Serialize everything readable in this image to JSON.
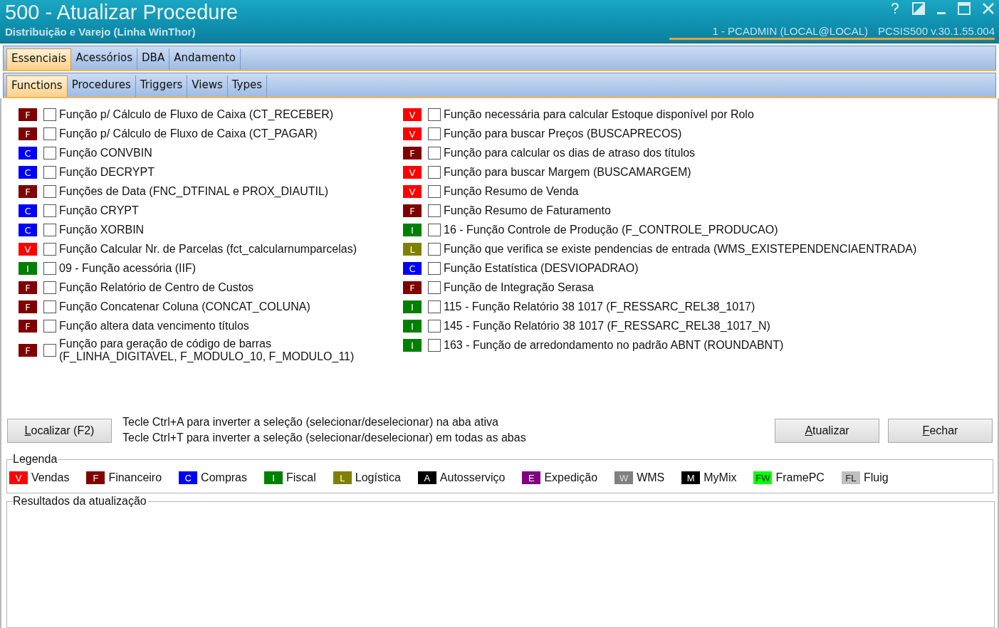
{
  "window": {
    "title": "500 - Atualizar Procedure",
    "subtitle": "Distribuição e Varejo (Linha WinThor)",
    "user": "1 - PCADMIN (LOCAL@LOCAL)",
    "version": "PCSIS500  v.30.1.55.004"
  },
  "tabs": [
    {
      "label": "Essenciais",
      "selected": true
    },
    {
      "label": "Acessórios",
      "selected": false
    },
    {
      "label": "DBA",
      "selected": false
    },
    {
      "label": "Andamento",
      "selected": false
    }
  ],
  "subtabs": [
    {
      "label": "Functions",
      "selected": true
    },
    {
      "label": "Procedures",
      "selected": false
    },
    {
      "label": "Triggers",
      "selected": false
    },
    {
      "label": "Views",
      "selected": false
    },
    {
      "label": "Types",
      "selected": false
    }
  ],
  "columns": [
    [
      {
        "badge": "F",
        "color": "#800000",
        "label": "Função p/ Cálculo de Fluxo de Caixa (CT_RECEBER)",
        "checked": false
      },
      {
        "badge": "F",
        "color": "#800000",
        "label": "Função p/ Cálculo de Fluxo de Caixa (CT_PAGAR)",
        "checked": false
      },
      {
        "badge": "C",
        "color": "#0000ff",
        "label": "Função CONVBIN",
        "checked": false
      },
      {
        "badge": "C",
        "color": "#0000ff",
        "label": "Função DECRYPT",
        "checked": false
      },
      {
        "badge": "F",
        "color": "#800000",
        "label": "Funções de Data (FNC_DTFINAL e PROX_DIAUTIL)",
        "checked": false
      },
      {
        "badge": "C",
        "color": "#0000ff",
        "label": "Função CRYPT",
        "checked": false
      },
      {
        "badge": "C",
        "color": "#0000ff",
        "label": "Função XORBIN",
        "checked": false
      },
      {
        "badge": "V",
        "color": "#ff0000",
        "label": "Função Calcular Nr. de Parcelas (fct_calcularnumparcelas)",
        "checked": false
      },
      {
        "badge": "I",
        "color": "#008000",
        "label": "09 - Função acessória (IIF)",
        "checked": false
      },
      {
        "badge": "F",
        "color": "#800000",
        "label": "Função Relatório de Centro de Custos",
        "checked": false
      },
      {
        "badge": "F",
        "color": "#800000",
        "label": "Função Concatenar Coluna (CONCAT_COLUNA)",
        "checked": false
      },
      {
        "badge": "F",
        "color": "#800000",
        "label": "Função altera data vencimento títulos",
        "checked": false
      },
      {
        "badge": "F",
        "color": "#800000",
        "label": "Função para geração de código de barras (F_LINHA_DIGITAVEL, F_MODULO_10, F_MODULO_11)",
        "checked": false
      }
    ],
    [
      {
        "badge": "V",
        "color": "#ff0000",
        "label": "Função necessária para calcular Estoque disponível por Rolo",
        "checked": false
      },
      {
        "badge": "V",
        "color": "#ff0000",
        "label": "Função para buscar Preços (BUSCAPRECOS)",
        "checked": false
      },
      {
        "badge": "F",
        "color": "#800000",
        "label": "Função para calcular os dias de atraso dos títulos",
        "checked": false
      },
      {
        "badge": "V",
        "color": "#ff0000",
        "label": "Função para buscar Margem (BUSCAMARGEM)",
        "checked": false
      },
      {
        "badge": "V",
        "color": "#ff0000",
        "label": "Função Resumo de Venda",
        "checked": false
      },
      {
        "badge": "F",
        "color": "#800000",
        "label": "Função Resumo de Faturamento",
        "checked": false
      },
      {
        "badge": "I",
        "color": "#008000",
        "label": "16 - Função Controle de Produção (F_CONTROLE_PRODUCAO)",
        "checked": false
      },
      {
        "badge": "L",
        "color": "#808000",
        "label": "Função que verifica se existe pendencias de entrada (WMS_EXISTEPENDENCIAENTRADA)",
        "checked": false
      },
      {
        "badge": "C",
        "color": "#0000ff",
        "label": "Função Estatística (DESVIOPADRAO)",
        "checked": false
      },
      {
        "badge": "F",
        "color": "#800000",
        "label": "Função de Integração Serasa",
        "checked": false
      },
      {
        "badge": "I",
        "color": "#008000",
        "label": "115 - Função Relatório 38 1017 (F_RESSARC_REL38_1017)",
        "checked": false
      },
      {
        "badge": "I",
        "color": "#008000",
        "label": "145 - Função Relatório 38 1017 (F_RESSARC_REL38_1017_N)",
        "checked": false
      },
      {
        "badge": "I",
        "color": "#008000",
        "label": "163 - Função de arredondamento no padrão ABNT (ROUNDABNT)",
        "checked": false
      }
    ]
  ],
  "find_button": "Localizar (F2)",
  "hints": [
    "Tecle Ctrl+A para inverter a seleção (selecionar/deselecionar) na aba ativa",
    "Tecle Ctrl+T para inverter a seleção (selecionar/deselecionar) em todas as abas"
  ],
  "buttons": [
    "Atualizar",
    "Fechar"
  ],
  "legend": {
    "title": "Legenda",
    "items": [
      {
        "badge": "V",
        "color": "#ff0000",
        "label": "Vendas"
      },
      {
        "badge": "F",
        "color": "#800000",
        "label": "Financeiro"
      },
      {
        "badge": "C",
        "color": "#0000ff",
        "label": "Compras"
      },
      {
        "badge": "I",
        "color": "#008000",
        "label": "Fiscal"
      },
      {
        "badge": "L",
        "color": "#808000",
        "label": "Logística"
      },
      {
        "badge": "A",
        "color": "#000000",
        "label": "Autosserviço"
      },
      {
        "badge": "E",
        "color": "#800080",
        "label": "Expedição"
      },
      {
        "badge": "W",
        "color": "#808080",
        "label": "WMS"
      },
      {
        "badge": "M",
        "color": "#000000",
        "label": "MyMix"
      },
      {
        "badge": "FW",
        "color": "#00ff00",
        "label": "FramePC"
      },
      {
        "badge": "FL",
        "color": "#c0c0c0",
        "label": "Fluig"
      }
    ]
  },
  "results": {
    "title": "Resultados da atualização"
  }
}
